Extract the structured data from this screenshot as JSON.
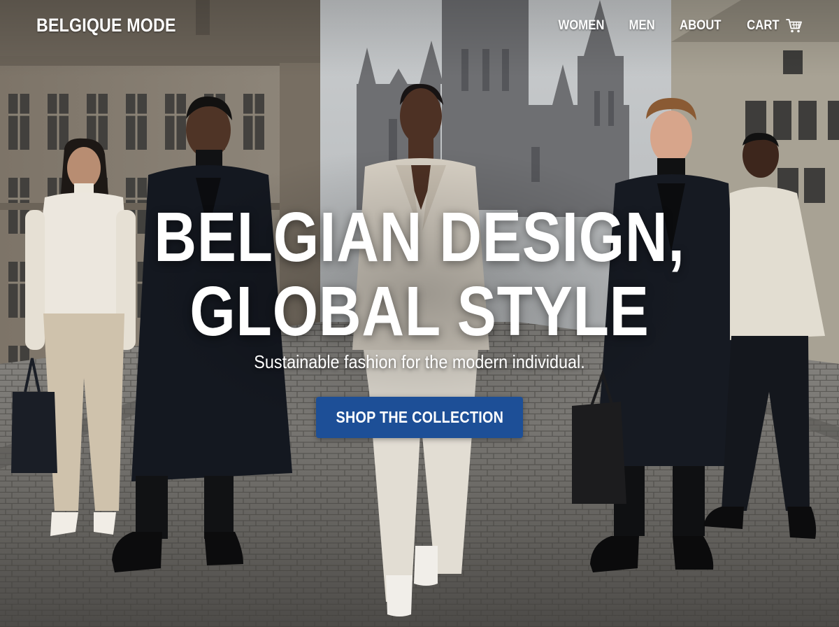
{
  "brand": {
    "name": "BELGIQUE MODE"
  },
  "nav": {
    "items": [
      "WOMEN",
      "MEN",
      "ABOUT"
    ],
    "cart_label": "CART",
    "cart_icon": "cart-icon"
  },
  "hero": {
    "headline_line1": "BELGIAN DESIGN,",
    "headline_line2": "GLOBAL STYLE",
    "tagline": "Sustainable fashion for the modern individual.",
    "cta_label": "SHOP THE COLLECTION",
    "background_image": "Five models in minimalist black, cream and beige outfits standing on a cobblestone street in front of gothic Belgian buildings"
  },
  "colors": {
    "cta_background": "#1d4f97",
    "text": "#ffffff"
  }
}
